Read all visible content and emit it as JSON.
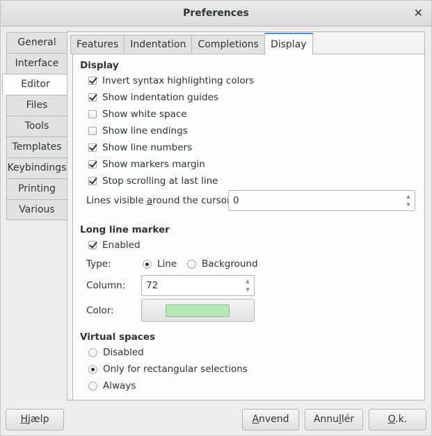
{
  "window": {
    "title": "Preferences"
  },
  "left_tabs": [
    "General",
    "Interface",
    "Editor",
    "Files",
    "Tools",
    "Templates",
    "Keybindings",
    "Printing",
    "Various"
  ],
  "left_tabs_active": "Editor",
  "top_tabs": [
    "Features",
    "Indentation",
    "Completions",
    "Display"
  ],
  "top_tabs_active": "Display",
  "display": {
    "heading": "Display",
    "options": [
      {
        "label": "Invert syntax highlighting colors",
        "checked": true
      },
      {
        "label": "Show indentation guides",
        "checked": true
      },
      {
        "label": "Show white space",
        "checked": false
      },
      {
        "label": "Show line endings",
        "checked": false
      },
      {
        "label": "Show line numbers",
        "checked": true
      },
      {
        "label": "Show markers margin",
        "checked": true
      },
      {
        "label": "Stop scrolling at last line",
        "checked": true
      }
    ],
    "lines_visible_pre": "Lines visible ",
    "lines_visible_mnemonic": "a",
    "lines_visible_post": "round the cursor:",
    "lines_visible_value": "0"
  },
  "long_line": {
    "heading": "Long line marker",
    "enabled_label": "Enabled",
    "enabled": true,
    "type_label": "Type:",
    "type_options": [
      "Line",
      "Background"
    ],
    "type_selected": "Line",
    "column_label": "Column:",
    "column_value": "72",
    "color_label": "Color:",
    "color_value": "#b6e7b6"
  },
  "virtual": {
    "heading": "Virtual spaces",
    "options": [
      "Disabled",
      "Only for rectangular selections",
      "Always"
    ],
    "selected": "Only for rectangular selections"
  },
  "buttons": {
    "help_mnemonic": "H",
    "help_rest": "jælp",
    "apply_mnemonic": "A",
    "apply_rest": "nvend",
    "cancel_pre": "Annu",
    "cancel_mnemonic": "l",
    "cancel_post": "lér",
    "ok_mnemonic": "O",
    "ok_rest": ".k."
  },
  "icons": {
    "close": "close-icon"
  }
}
